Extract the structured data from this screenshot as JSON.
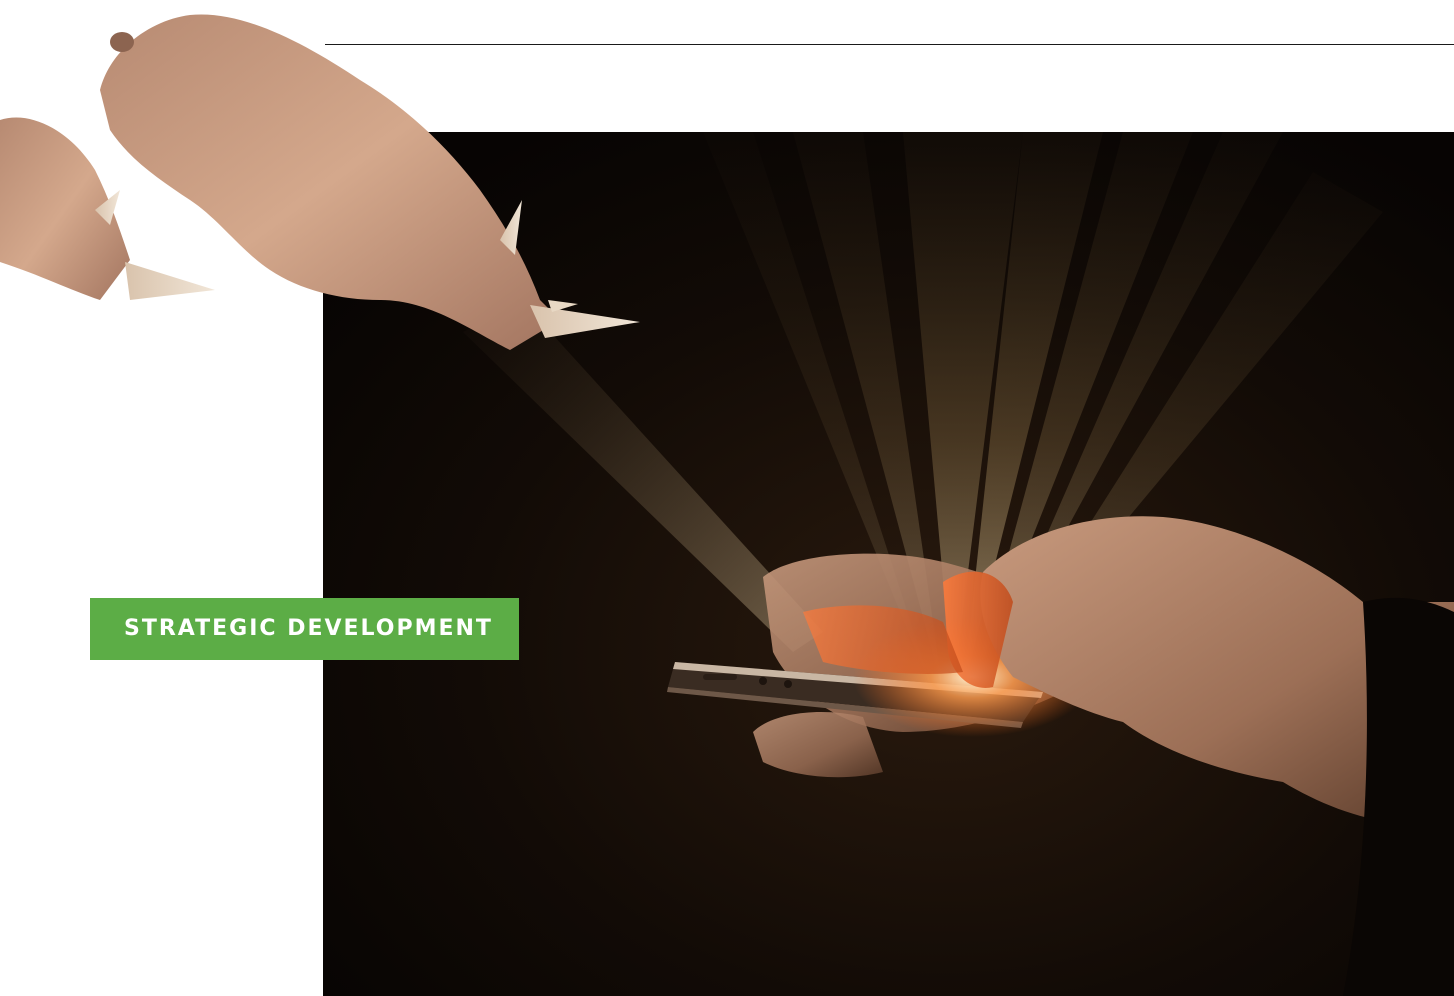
{
  "section": {
    "label": "STRATEGIC DEVELOPMENT"
  },
  "images": {
    "hero": "hands-holding-smartphone-with-light-beams",
    "decoration": "rhinos-icon"
  },
  "colors": {
    "accent": "#5cad46",
    "photo_background": "#0b0704",
    "beam": "#e8c98a",
    "rhino_skin": "#c79a7e"
  }
}
